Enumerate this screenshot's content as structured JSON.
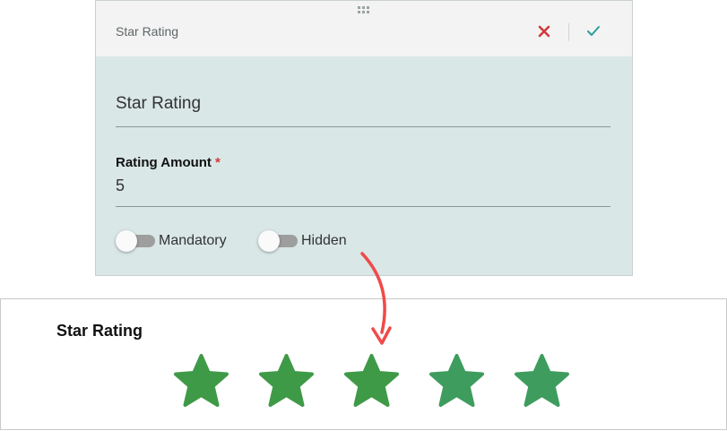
{
  "editor": {
    "header_title": "Star Rating",
    "cancel_icon": "close-icon",
    "confirm_icon": "check-icon",
    "title_field_value": "Star Rating",
    "rating_amount_label": "Rating Amount",
    "required_marker": "*",
    "rating_amount_value": "5",
    "toggles": [
      {
        "label": "Mandatory",
        "on": false
      },
      {
        "label": "Hidden",
        "on": false
      }
    ]
  },
  "preview": {
    "title": "Star Rating",
    "star_count": 5
  },
  "colors": {
    "accent_cancel": "#d3373b",
    "accent_confirm": "#2a9d9d",
    "star_green": "#3f9a47",
    "star_green_light": "#3e9c5f",
    "arrow_red": "#f04a4a",
    "panel_bg": "#d9e7e6"
  }
}
